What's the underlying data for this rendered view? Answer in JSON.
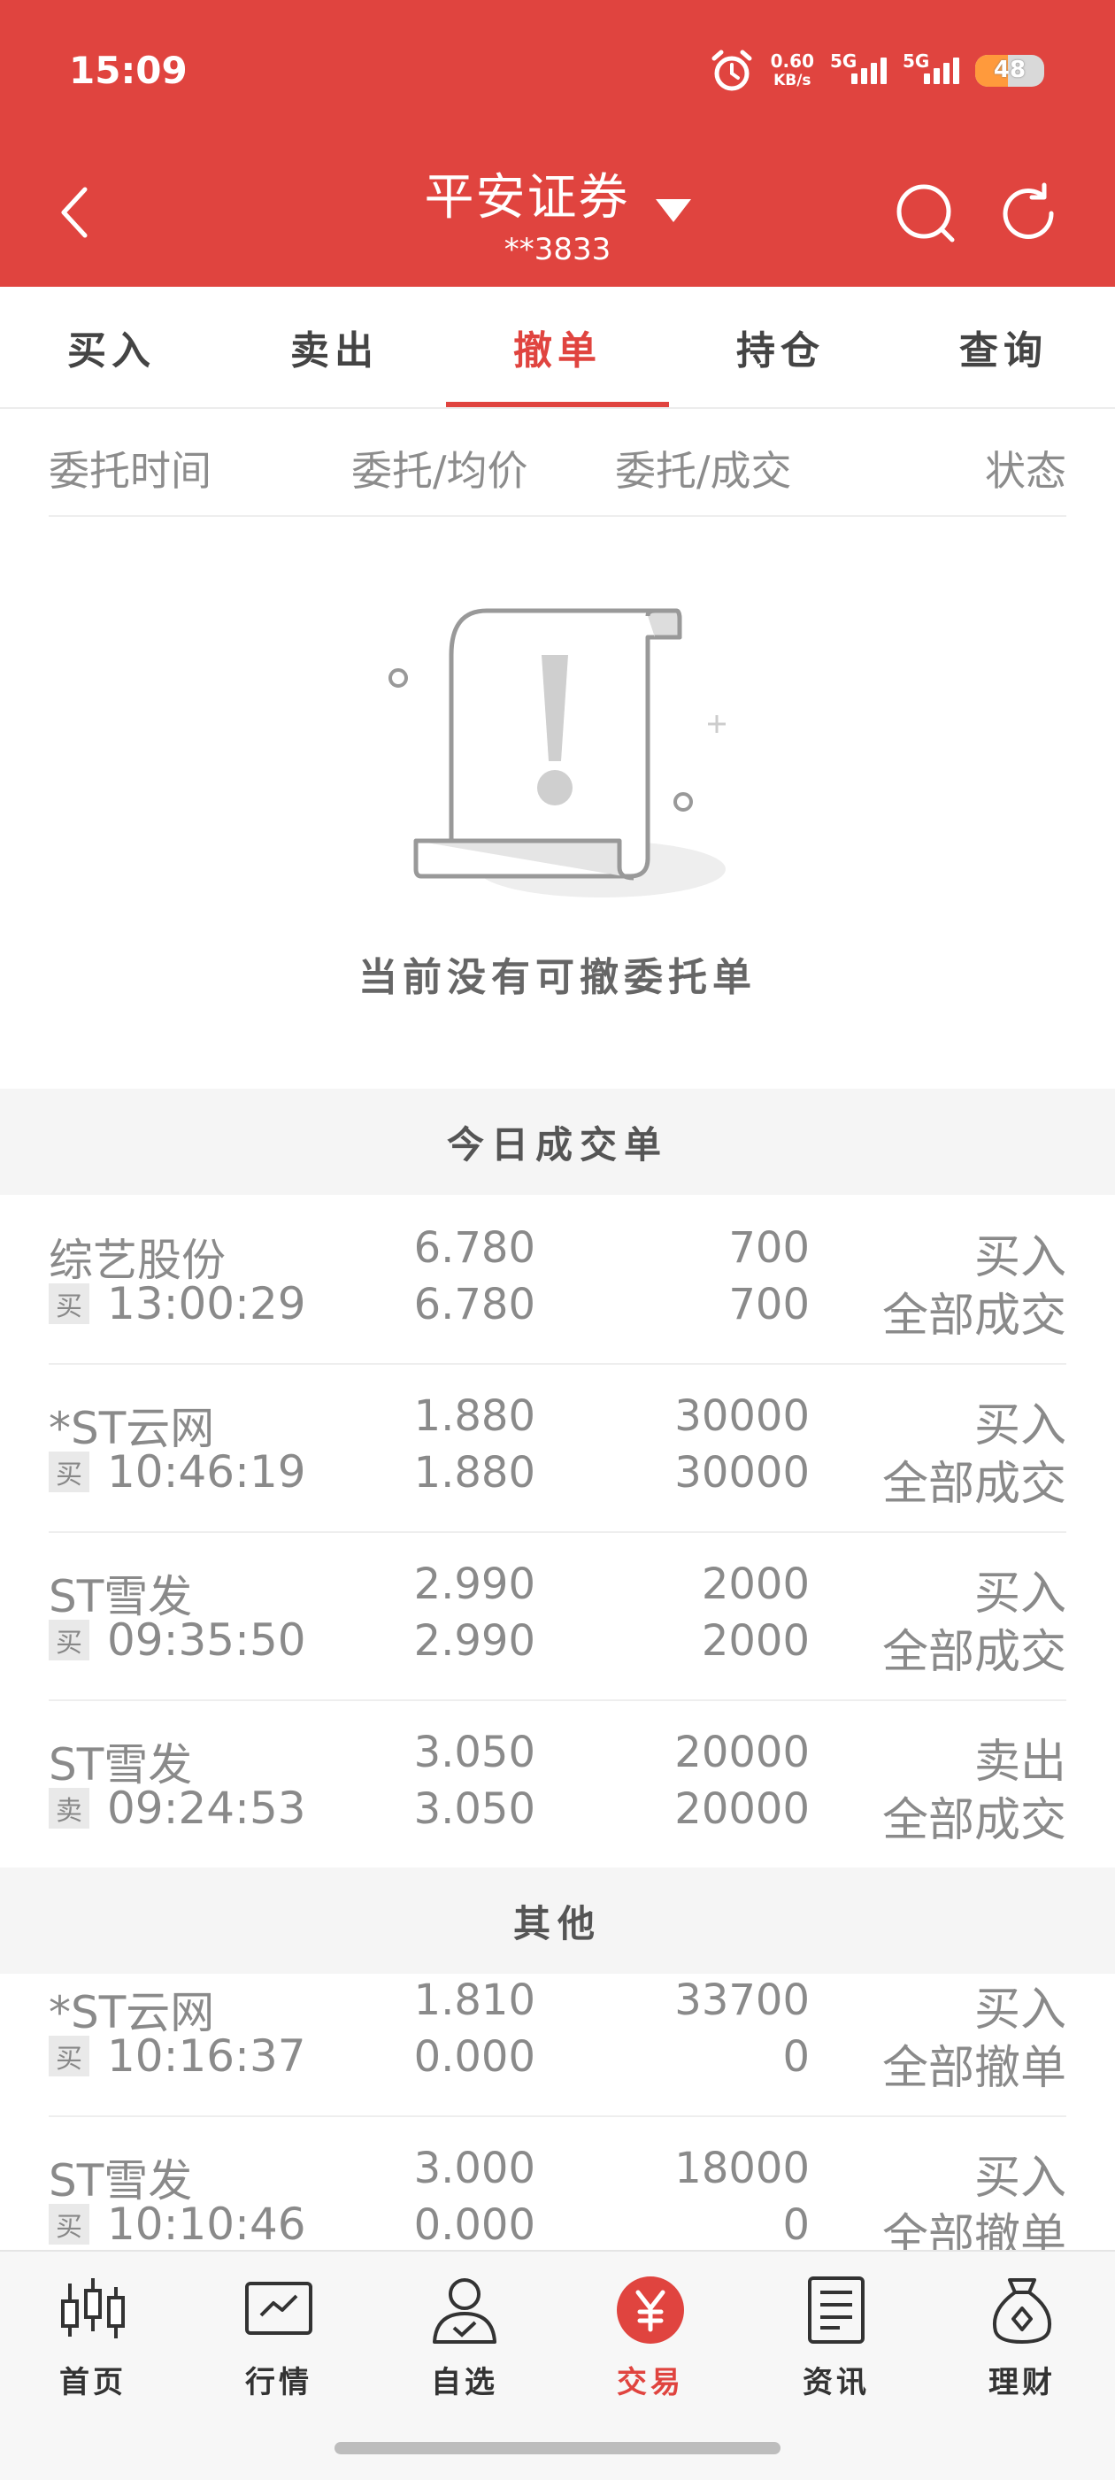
{
  "status_bar": {
    "time": "15:09",
    "net_speed_value": "0.60",
    "net_speed_unit": "KB/s",
    "sim1_tag": "5G",
    "sim2_tag": "5G",
    "battery": "48",
    "battery_level": 0.48
  },
  "header": {
    "title": "平安证券",
    "account": "**3833",
    "color": "#e0443f"
  },
  "tabs": [
    "买入",
    "卖出",
    "撤单",
    "持仓",
    "查询"
  ],
  "active_tab": "撤单",
  "columns": {
    "time": "委托时间",
    "price": "委托/均价",
    "qty": "委托/成交",
    "status": "状态"
  },
  "empty_message": "当前没有可撤委托单",
  "today_section_title": "今日成交单",
  "today_trades": [
    {
      "name": "综艺股份",
      "badge": "买",
      "time": "13:00:29",
      "price": "6.780",
      "avg_price": "6.780",
      "qty": "700",
      "filled": "700",
      "side": "买入",
      "status": "全部成交"
    },
    {
      "name": "*ST云网",
      "badge": "买",
      "time": "10:46:19",
      "price": "1.880",
      "avg_price": "1.880",
      "qty": "30000",
      "filled": "30000",
      "side": "买入",
      "status": "全部成交"
    },
    {
      "name": "ST雪发",
      "badge": "买",
      "time": "09:35:50",
      "price": "2.990",
      "avg_price": "2.990",
      "qty": "2000",
      "filled": "2000",
      "side": "买入",
      "status": "全部成交"
    },
    {
      "name": "ST雪发",
      "badge": "卖",
      "time": "09:24:53",
      "price": "3.050",
      "avg_price": "3.050",
      "qty": "20000",
      "filled": "20000",
      "side": "卖出",
      "status": "全部成交"
    }
  ],
  "other_section_title": "其他",
  "other_orders": [
    {
      "name": "*ST云网",
      "badge": "买",
      "time": "10:16:37",
      "price": "1.810",
      "avg_price": "0.000",
      "qty": "33700",
      "filled": "0",
      "side": "买入",
      "status": "全部撤单"
    },
    {
      "name": "ST雪发",
      "badge": "买",
      "time": "10:10:46",
      "price": "3.000",
      "avg_price": "0.000",
      "qty": "18000",
      "filled": "0",
      "side": "买入",
      "status": "全部撤单"
    }
  ],
  "bottom_nav": [
    {
      "label": "首页",
      "icon": "candlestick-icon"
    },
    {
      "label": "行情",
      "icon": "market-chart-icon"
    },
    {
      "label": "自选",
      "icon": "user-check-icon"
    },
    {
      "label": "交易",
      "icon": "yuan-icon"
    },
    {
      "label": "资讯",
      "icon": "news-doc-icon"
    },
    {
      "label": "理财",
      "icon": "money-bag-icon"
    }
  ],
  "active_nav": "交易"
}
